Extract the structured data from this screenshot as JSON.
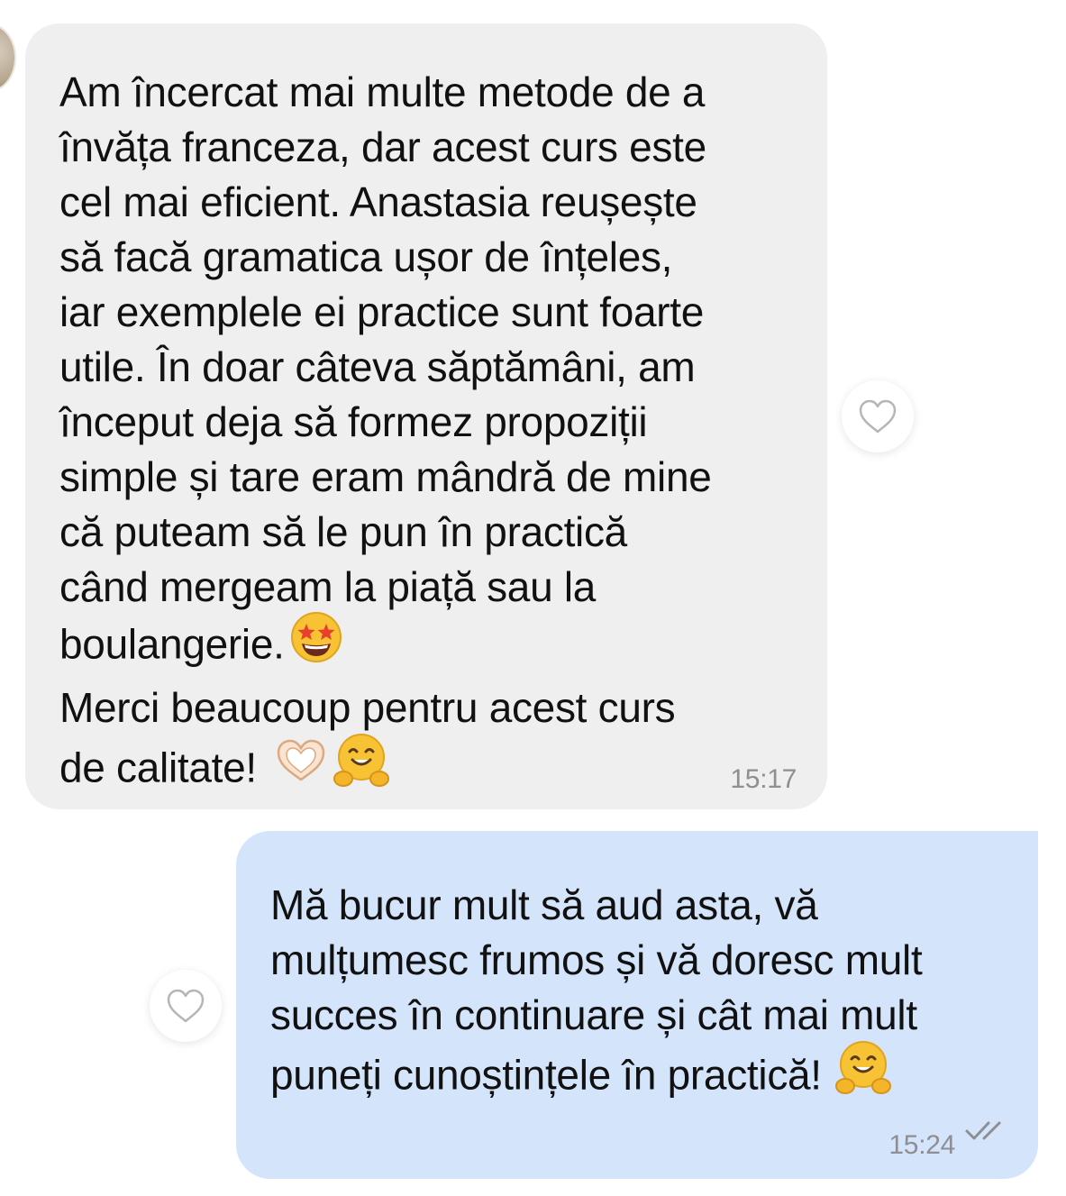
{
  "messages": [
    {
      "direction": "incoming",
      "lines": [
        "Am încercat mai multe metode de a",
        "învăța franceza, dar acest curs este",
        "cel mai eficient. Anastasia reușește",
        "să facă gramatica ușor de înțeles,",
        "iar exemplele ei practice sunt foarte",
        "utile. În doar câteva săptămâni, am",
        "început deja să formez propoziții",
        "simple și tare eram mândră de mine",
        "că puteam să le pun în practică",
        "când mergeam la piață sau la",
        "boulangerie.",
        "Merci beaucoup pentru acest curs",
        "de calitate!"
      ],
      "emojis": [
        "star-struck-emoji",
        "heart-hands-emoji",
        "hugging-face-emoji"
      ],
      "time": "15:17"
    },
    {
      "direction": "outgoing",
      "lines": [
        "Mă bucur mult să aud asta, vă",
        "mulțumesc frumos și vă doresc mult",
        "succes în continuare și cât mai mult",
        "puneți cunoștințele în practică!"
      ],
      "emojis": [
        "hugging-face-emoji"
      ],
      "time": "15:24",
      "status": "read"
    }
  ],
  "icons": {
    "like": "heart-outline-icon",
    "read_receipt": "double-check-icon"
  },
  "colors": {
    "incoming_bubble": "#efefef",
    "outgoing_bubble": "#d3e4fb",
    "text": "#111111",
    "timestamp": "#8e8e93"
  }
}
